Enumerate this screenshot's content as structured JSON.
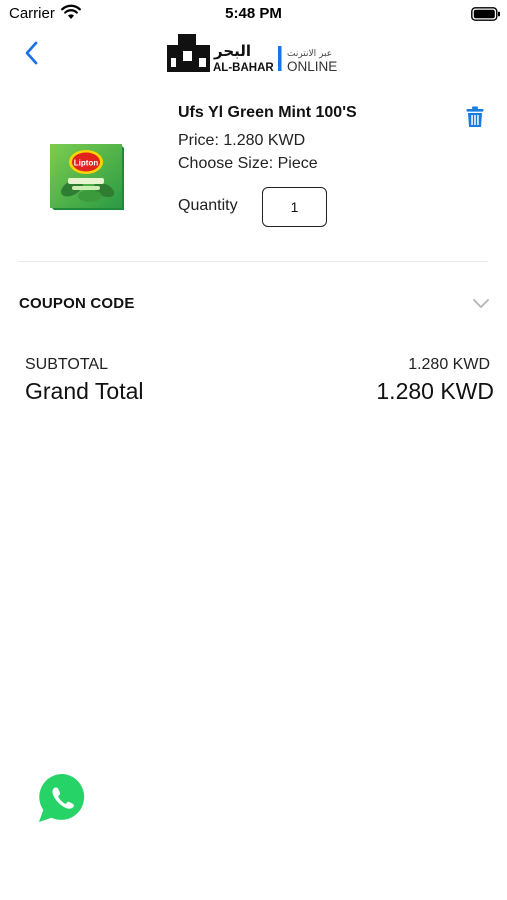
{
  "status_bar": {
    "carrier": "Carrier",
    "time": "5:48 PM",
    "icons": [
      "wifi-icon",
      "battery-icon"
    ]
  },
  "header": {
    "back_icon": "chevron-left-icon",
    "logo": {
      "brand_en": "AL-BAHAR",
      "brand_ar": "البحر",
      "suffix_en": "ONLINE",
      "suffix_ar": "عبر الانترنت"
    }
  },
  "cart_item": {
    "name": "Ufs Yl Green Mint 100'S",
    "price": "Price: 1.280 KWD",
    "size": "Choose Size: Piece",
    "quantity_label": "Quantity",
    "quantity_value": "1",
    "image_icon": "lipton-green-tea-box",
    "delete_icon": "trash-icon"
  },
  "coupon": {
    "label": "COUPON CODE",
    "chevron_icon": "chevron-down-icon"
  },
  "totals": {
    "subtotal_label": "SUBTOTAL",
    "subtotal_value": "1.280 KWD",
    "grand_total_label": "Grand Total",
    "grand_total_value": "1.280 KWD"
  },
  "floating": {
    "whatsapp_icon": "whatsapp-icon"
  },
  "colors": {
    "accent": "#1a73e8",
    "delete": "#1a7be0",
    "whatsapp": "#25d366",
    "divider": "#e6e6e6"
  }
}
